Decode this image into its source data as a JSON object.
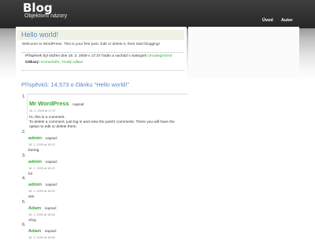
{
  "site": {
    "title": "Blog",
    "description": "Objektivní názory",
    "nav": [
      "Úvod",
      "Autor"
    ]
  },
  "post": {
    "title": "Hello world!",
    "body": "Welcome to WordPress. This is your first post. Edit or delete it, then start blogging!",
    "meta_prefix": "Příspěvek byl vložen dne 18. 2. 2009 v 17:37 hodin a nachází v kategorii",
    "category": "Uncategorized",
    "refs_label": "Odkazy:",
    "refs_link1": "Komentáře",
    "refs_link2": "Trvalý odkaz"
  },
  "comments_heading": "Příspěvků: 14,573 o článku \"Hello world!\"",
  "comments": [
    {
      "num": "1.",
      "author": "Mr WordPress",
      "wrote": "napsal:",
      "date": "18. 2. 2009 at 17:37",
      "lines": [
        "Hi, this is a comment.",
        "To delete a comment, just log in and view the post's comments. There you will have the",
        "option to edit or delete them."
      ]
    },
    {
      "num": "2.",
      "author": "admin",
      "wrote": "napsal:",
      "date": "18. 2. 2009 at 18:22",
      "lines": [
        "boring"
      ]
    },
    {
      "num": "3.",
      "author": "admin",
      "wrote": "napsal:",
      "date": "18. 2. 2009 at 18:22",
      "lines": [
        "lol"
      ]
    },
    {
      "num": "4.",
      "author": "admin",
      "wrote": "napsal:",
      "date": "18. 2. 2009 at 18:22",
      "lines": [
        "sss"
      ]
    },
    {
      "num": "5.",
      "author": "Adam",
      "wrote": "napsal:",
      "date": "18. 2. 2009 at 18:58",
      "lines": [
        "Ahoj"
      ]
    },
    {
      "num": "6.",
      "author": "Adam",
      "wrote": "napsal:",
      "date": "18. 2. 2009 at 18:58",
      "lines": []
    }
  ],
  "colors": {
    "link": "#3aa83a",
    "heading": "#5a86c9",
    "header_bg": "#303030"
  }
}
